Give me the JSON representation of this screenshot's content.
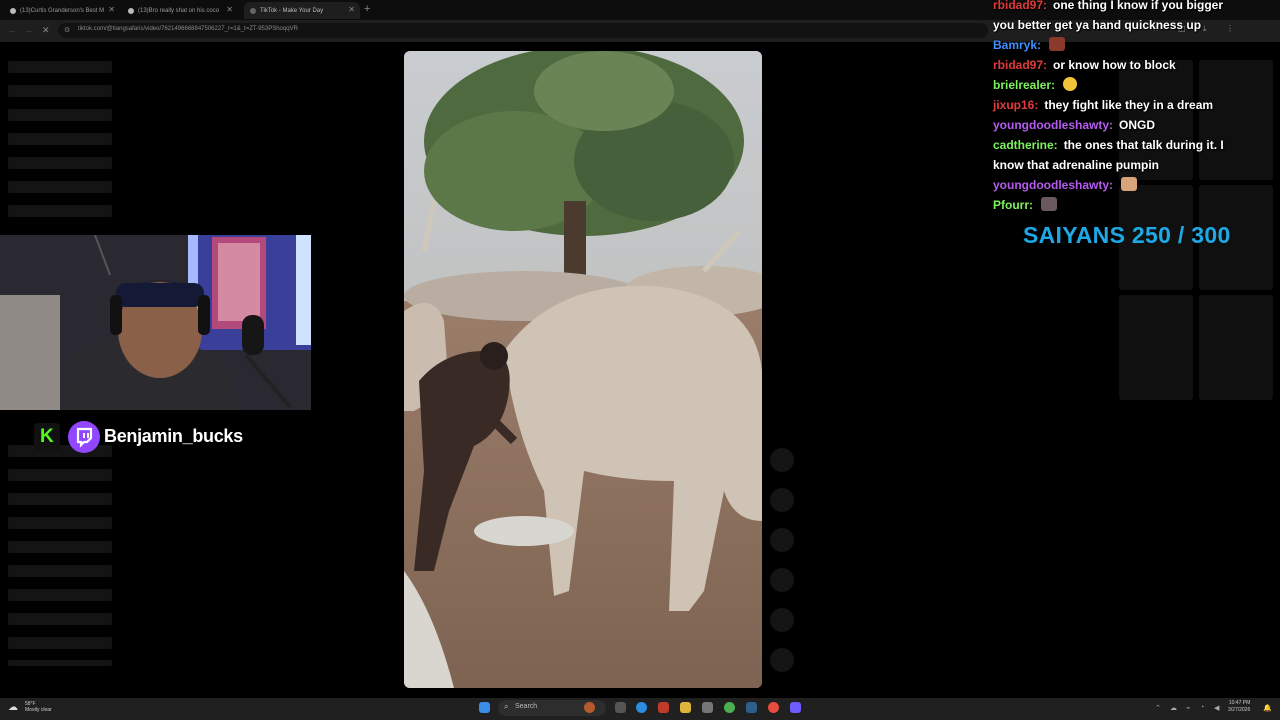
{
  "browser": {
    "tabs": [
      {
        "label": "(13)Curtis Granderson's Best M"
      },
      {
        "label": "(13)Bro really shat on his coco"
      },
      {
        "label": "TikTok - Make Your Day"
      }
    ],
    "new_tab": "+",
    "url": "tiktok.com/@tiangsafaris/video/7621496668847506227_r=1&_t=ZT-953PShoqqVR"
  },
  "stream": {
    "streamer_name": "Benjamin_bucks",
    "kick_logo": "K",
    "twitch_logo": "twitch-icon"
  },
  "chat": {
    "messages": [
      {
        "user": "rbidad97:",
        "text": "one thing I know if you bigger",
        "color": "#e23b3b"
      },
      {
        "user": "",
        "text": "you better get ya hand quickness up",
        "color": "#ffffff"
      },
      {
        "user": "Bamryk:",
        "text": "",
        "color": "#3f8fff"
      },
      {
        "user": "rbidad97:",
        "text": "or know how to block",
        "color": "#e23b3b"
      },
      {
        "user": "brielrealer:",
        "text": "",
        "color": "#7cf25b"
      },
      {
        "user": "jixup16:",
        "text": "they fight like they in a dream",
        "color": "#e23b3b"
      },
      {
        "user": "youngdoodleshawty:",
        "text": "ONGD",
        "color": "#b45cf0"
      },
      {
        "user": "cadtherine:",
        "text": "the ones that talk during it. I",
        "color": "#7cf25b"
      },
      {
        "user": "",
        "text": "know that adrenaline pumpin",
        "color": "#ffffff"
      },
      {
        "user": "youngdoodleshawty:",
        "text": "",
        "color": "#b45cf0"
      },
      {
        "user": "Pfourr:",
        "text": "",
        "color": "#7cf25b"
      }
    ],
    "goal_text": "SAIYANS 250 / 300"
  },
  "taskbar": {
    "weather_temp": "58°F",
    "weather_desc": "Mostly clear",
    "search_placeholder": "Search",
    "time": "10:47 PM",
    "date": "3/27/2026"
  },
  "colors": {
    "kick_green": "#53fc18",
    "twitch_purple": "#9146ff",
    "goal_blue": "#1ea9e6"
  }
}
